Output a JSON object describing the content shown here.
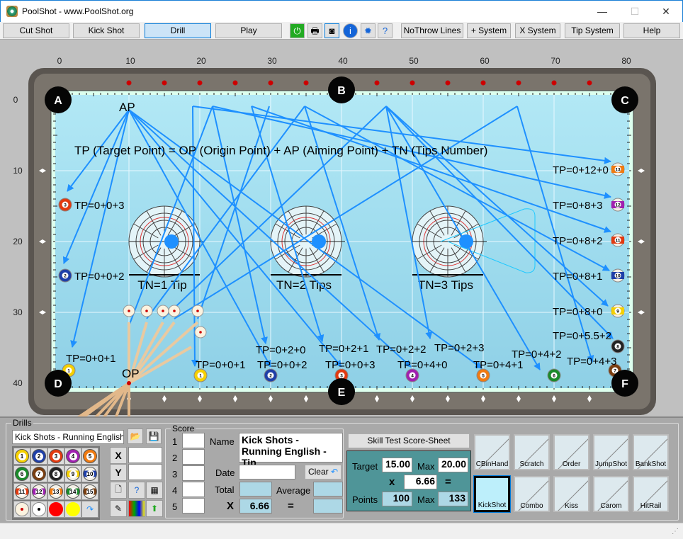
{
  "window": {
    "title": "PoolShot - www.PoolShot.org",
    "minimize": "—",
    "maximize": "☐",
    "close": "✕"
  },
  "toolbar": {
    "modes": [
      "Cut Shot",
      "Kick Shot",
      "Drill",
      "Play"
    ],
    "selected_mode": "Drill",
    "icons": [
      "power-icon",
      "printer-icon",
      "camera-icon",
      "info-icon",
      "gear-icon",
      "help-document-icon"
    ],
    "buttons": [
      "NoThrow Lines",
      "+ System",
      "X System",
      "Tip System",
      "Help"
    ]
  },
  "table": {
    "x_ticks": [
      "0",
      "10",
      "20",
      "30",
      "40",
      "50",
      "60",
      "70",
      "80"
    ],
    "y_ticks": [
      "0",
      "10",
      "20",
      "30",
      "40"
    ],
    "pockets": [
      "A",
      "B",
      "C",
      "D",
      "E",
      "F"
    ],
    "formula": "TP (Target Point) = OP (Origin Point) + AP (Aiming Point) + TN (Tips Number)",
    "ap_label": "AP",
    "op_label": "OP",
    "tip_labels": [
      "TN=1 Tip",
      "TN=2 Tips",
      "TN=3 Tips"
    ],
    "tip_offsets": [
      1,
      2,
      3
    ],
    "tp_labels": [
      {
        "text": "TP=0+0+3",
        "ball": 3
      },
      {
        "text": "TP=0+0+2",
        "ball": 2
      },
      {
        "text": "TP=0+0+1",
        "ball": 1
      },
      {
        "text": "TP=0+0+1",
        "ball": 1
      },
      {
        "text": "TP=0+2+0"
      },
      {
        "text": "TP=0+0+2",
        "ball": 2
      },
      {
        "text": "TP=0+2+1"
      },
      {
        "text": "TP=0+0+3",
        "ball": 3
      },
      {
        "text": "TP=0+2+2"
      },
      {
        "text": "TP=0+4+0",
        "ball": 4
      },
      {
        "text": "TP=0+2+3"
      },
      {
        "text": "TP=0+4+1",
        "ball": 5
      },
      {
        "text": "TP=0+4+2",
        "ball": 6
      },
      {
        "text": "TP=0+4+3",
        "ball": 7
      },
      {
        "text": "TP=0+5.5+2",
        "ball": 8
      },
      {
        "text": "TP=0+8+0",
        "ball": 9
      },
      {
        "text": "TP=0+8+1",
        "ball": 10
      },
      {
        "text": "TP=0+8+2",
        "ball": 11
      },
      {
        "text": "TP=0+8+3",
        "ball": 12
      },
      {
        "text": "TP=0+12+0",
        "ball": 13
      }
    ],
    "ball_colors": {
      "1": "#f5d000",
      "2": "#1f3fa8",
      "3": "#e23a10",
      "4": "#a020b0",
      "5": "#f07a10",
      "6": "#1a8a2a",
      "7": "#7a3e10",
      "8": "#222222",
      "9": "#f5d000",
      "10": "#1f3fa8",
      "11": "#e23a10",
      "12": "#a020b0",
      "13": "#f07a10",
      "14": "#1a8a2a",
      "15": "#7a3e10"
    },
    "felt_color": "#9fdcee",
    "line_color": "#1e90ff"
  },
  "drills": {
    "label": "Drills",
    "name_value": "Kick Shots - Running English  - T",
    "x_label": "X",
    "y_label": "Y",
    "x_value": "",
    "y_value": "",
    "balls": [
      "1",
      "2",
      "3",
      "4",
      "5",
      "6",
      "7",
      "8",
      "9",
      "10",
      "11",
      "12",
      "13",
      "14",
      "15"
    ]
  },
  "score": {
    "label": "Score",
    "rows": [
      "1",
      "2",
      "3",
      "4",
      "5"
    ],
    "name_label": "Name",
    "name_value": "Kick Shots - Running English  - Tip",
    "date_label": "Date",
    "date_value": "",
    "clear": "Clear",
    "total_label": "Total",
    "average_label": "Average",
    "x_label": "X",
    "multiplier": "6.66",
    "eq": "="
  },
  "skill": {
    "title": "Skill Test Score-Sheet",
    "target_label": "Target",
    "target": "15.00",
    "max_label": "Max",
    "max": "20.00",
    "x_label": "x",
    "multiplier": "6.66",
    "eq": "=",
    "points_label": "Points",
    "points": "100",
    "points_max_label": "Max",
    "points_max": "133"
  },
  "drill_types": [
    "CBinHand",
    "Scratch",
    "Order",
    "JumpShot",
    "BankShot",
    "KickShot",
    "Combo",
    "Kiss",
    "Carom",
    "HitRail"
  ],
  "selected_drill_type": "KickShot"
}
